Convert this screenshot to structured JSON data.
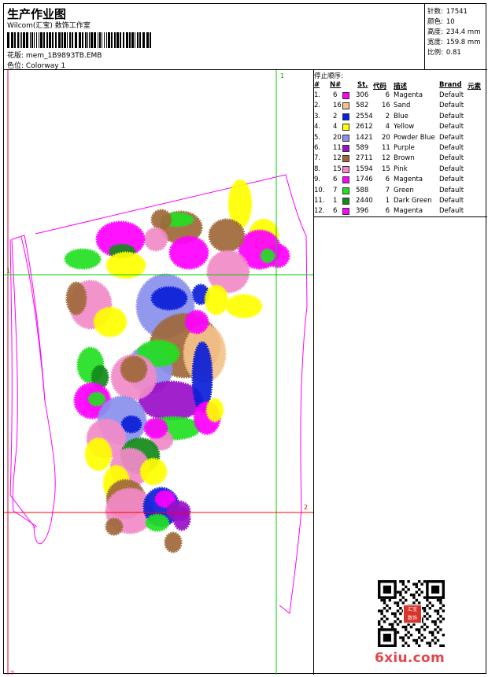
{
  "header": {
    "title": "生产作业图",
    "company": "Wilcom(汇宝) 数饰工作室",
    "design_label": "花版:",
    "design_value": "mem_1B9893TB.EMB",
    "colorway_label": "色位:",
    "colorway_value": "Colorway 1"
  },
  "stats": [
    {
      "label": "针数:",
      "value": "17541"
    },
    {
      "label": "颜色:",
      "value": "10"
    },
    {
      "label": "高度:",
      "value": "234.4 mm"
    },
    {
      "label": "宽度:",
      "value": "159.8 mm"
    },
    {
      "label": "比例:",
      "value": "0.81"
    }
  ],
  "canvas": {
    "guide_marks": {
      "green_top": "1",
      "green_left": "1",
      "red_right": "2",
      "red_bottom": "2"
    },
    "colors": {
      "magenta": "#ff00ff",
      "sand": "#f5c38a",
      "blue": "#0a1fd8",
      "yellow": "#ffff00",
      "powder_blue": "#8a90ee",
      "purple": "#9a10c8",
      "brown": "#a0693a",
      "pink": "#f28ac8",
      "green": "#22e022",
      "dark_green": "#138a1b",
      "guide_green": "#00d000",
      "guide_red": "#ff0000"
    }
  },
  "legend": {
    "heading": "停止顺序:",
    "columns": {
      "num": "#",
      "needle": "N#",
      "stitches": "St.",
      "code": "代码",
      "desc": "描述",
      "brand": "Brand",
      "elem": "元素"
    },
    "rows": [
      {
        "num": "1.",
        "needle": "6",
        "color": "#ff00ff",
        "stitches": "306",
        "code": "6",
        "desc": "Magenta",
        "brand": "Default"
      },
      {
        "num": "2.",
        "needle": "16",
        "color": "#f5c38a",
        "stitches": "582",
        "code": "16",
        "desc": "Sand",
        "brand": "Default"
      },
      {
        "num": "3.",
        "needle": "2",
        "color": "#0a1fd8",
        "stitches": "2554",
        "code": "2",
        "desc": "Blue",
        "brand": "Default"
      },
      {
        "num": "4.",
        "needle": "4",
        "color": "#ffff00",
        "stitches": "2612",
        "code": "4",
        "desc": "Yellow",
        "brand": "Default"
      },
      {
        "num": "5.",
        "needle": "20",
        "color": "#8a90ee",
        "stitches": "1421",
        "code": "20",
        "desc": "Powder Blue",
        "brand": "Default"
      },
      {
        "num": "6.",
        "needle": "11",
        "color": "#9a10c8",
        "stitches": "589",
        "code": "11",
        "desc": "Purple",
        "brand": "Default"
      },
      {
        "num": "7.",
        "needle": "12",
        "color": "#a0693a",
        "stitches": "2711",
        "code": "12",
        "desc": "Brown",
        "brand": "Default"
      },
      {
        "num": "8.",
        "needle": "15",
        "color": "#f28ac8",
        "stitches": "1594",
        "code": "15",
        "desc": "Pink",
        "brand": "Default"
      },
      {
        "num": "9.",
        "needle": "6",
        "color": "#ff00ff",
        "stitches": "1746",
        "code": "6",
        "desc": "Magenta",
        "brand": "Default"
      },
      {
        "num": "10.",
        "needle": "7",
        "color": "#22e022",
        "stitches": "588",
        "code": "7",
        "desc": "Green",
        "brand": "Default"
      },
      {
        "num": "11.",
        "needle": "1",
        "color": "#138a1b",
        "stitches": "2440",
        "code": "1",
        "desc": "Dark Green",
        "brand": "Default"
      },
      {
        "num": "12.",
        "needle": "6",
        "color": "#ff00ff",
        "stitches": "396",
        "code": "6",
        "desc": "Magenta",
        "brand": "Default"
      }
    ]
  },
  "watermark": {
    "text": "6xiu.com",
    "seal_text": "汇宝 数饰"
  }
}
